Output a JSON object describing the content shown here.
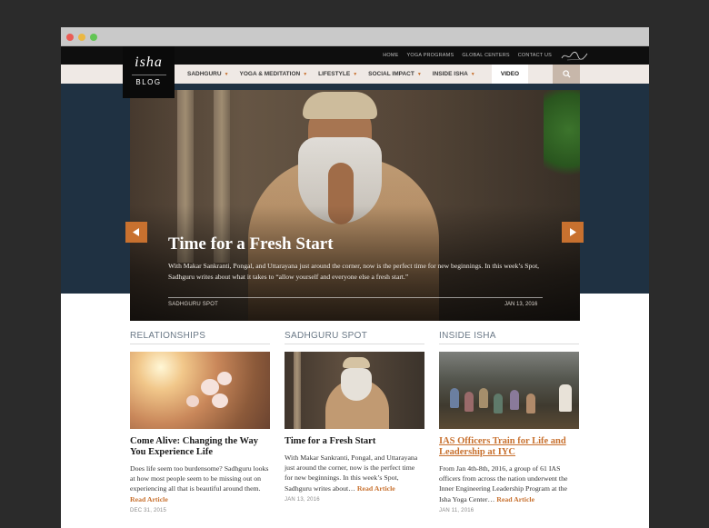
{
  "top_links": [
    "HOME",
    "YOGA PROGRAMS",
    "GLOBAL CENTERS",
    "CONTACT US"
  ],
  "logo": {
    "mark": "isha",
    "label": "BLOG"
  },
  "nav": {
    "items": [
      "SADHGURU",
      "YOGA & MEDITATION",
      "LIFESTYLE",
      "SOCIAL IMPACT",
      "INSIDE ISHA"
    ],
    "video": "VIDEO"
  },
  "hero": {
    "title": "Time for a Fresh Start",
    "excerpt": "With Makar Sankranti, Pongal, and Uttarayana just around the corner, now is the perfect time for new beginnings. In this week’s Spot, Sadhguru writes about what it takes to “allow yourself and everyone else a fresh start.”",
    "category": "SADHGURU SPOT",
    "date": "JAN 13, 2016"
  },
  "columns": [
    {
      "heading": "RELATIONSHIPS",
      "title": "Come Alive: Changing the Way You Experience Life",
      "excerpt": "Does life seem too burdensome? Sadhguru looks at how most people seem to be missing out on experiencing all that is beautiful around them.",
      "read_more": "Read Article",
      "date": "DEC 31, 2015"
    },
    {
      "heading": "SADHGURU SPOT",
      "title": "Time for a Fresh Start",
      "excerpt": "With Makar Sankranti, Pongal, and Uttarayana just around the corner, now is the perfect time for new beginnings. In this week’s Spot, Sadhguru writes about…",
      "read_more": "Read Article",
      "date": "JAN 13, 2016"
    },
    {
      "heading": "INSIDE ISHA",
      "title": "IAS Officers Train for Life and Leadership at IYC",
      "excerpt": "From Jan 4th-8th, 2016, a group of 61 IAS officers from across the nation underwent the Inner Engineering Leadership Program at the Isha Yoga Center…",
      "read_more": "Read Article",
      "date": "JAN 11, 2016"
    }
  ],
  "colors": {
    "accent": "#c8712f",
    "hero_bg": "#1f3142",
    "nav_bg": "#efe9e5",
    "top_bar": "#0e0e0e"
  },
  "icons": [
    "search-icon",
    "chevron-left-icon",
    "chevron-right-icon",
    "caret-down-icon",
    "signature-icon"
  ]
}
